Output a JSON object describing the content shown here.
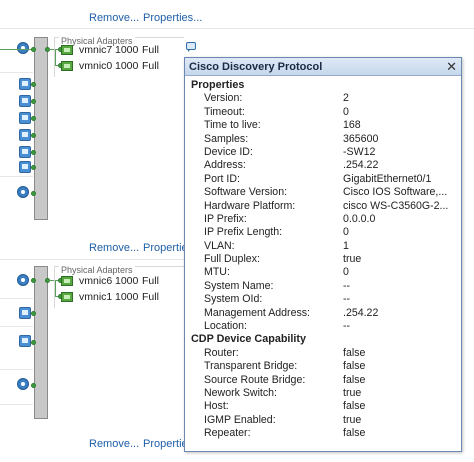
{
  "switches": [
    {
      "links": {
        "remove": "Remove...",
        "properties": "Properties..."
      },
      "physical_adapters": {
        "label": "Physical Adapters",
        "nics": [
          {
            "name": "vmnic7",
            "speed": "1000",
            "duplex": "Full"
          },
          {
            "name": "vmnic0",
            "speed": "1000",
            "duplex": "Full"
          }
        ]
      }
    },
    {
      "links": {
        "remove": "Remove...",
        "properties": "Properties"
      },
      "physical_adapters": {
        "label": "Physical Adapters",
        "nics": [
          {
            "name": "vmnic6",
            "speed": "1000",
            "duplex": "Full"
          },
          {
            "name": "vmnic1",
            "speed": "1000",
            "duplex": "Full"
          }
        ]
      }
    },
    {
      "links": {
        "remove": "Remove...",
        "properties": "Properties"
      }
    }
  ],
  "cdp_popup": {
    "title": "Cisco Discovery Protocol",
    "close_glyph": "✕",
    "properties_heading": "Properties",
    "properties": [
      {
        "k": "Version:",
        "v": "2"
      },
      {
        "k": "Timeout:",
        "v": "0"
      },
      {
        "k": "Time to live:",
        "v": "168"
      },
      {
        "k": "Samples:",
        "v": "365600"
      },
      {
        "k": "Device ID:",
        "v": "-SW12"
      },
      {
        "k": "Address:",
        "v": ".254.22"
      },
      {
        "k": "Port ID:",
        "v": "GigabitEthernet0/1"
      },
      {
        "k": "Software Version:",
        "v": "Cisco IOS Software,..."
      },
      {
        "k": "Hardware Platform:",
        "v": "cisco WS-C3560G-2..."
      },
      {
        "k": "IP Prefix:",
        "v": "0.0.0.0"
      },
      {
        "k": "IP Prefix Length:",
        "v": "0"
      },
      {
        "k": "VLAN:",
        "v": "1"
      },
      {
        "k": "Full Duplex:",
        "v": "true"
      },
      {
        "k": "MTU:",
        "v": "0"
      },
      {
        "k": "System Name:",
        "v": "--"
      },
      {
        "k": "System OId:",
        "v": "--"
      },
      {
        "k": "Management Address:",
        "v": ".254.22"
      },
      {
        "k": "Location:",
        "v": "--"
      }
    ],
    "capability_heading": "CDP Device Capability",
    "capabilities": [
      {
        "k": "Router:",
        "v": "false"
      },
      {
        "k": "Transparent Bridge:",
        "v": "false"
      },
      {
        "k": "Source Route Bridge:",
        "v": "false"
      },
      {
        "k": "Nework Switch:",
        "v": "true"
      },
      {
        "k": "Host:",
        "v": "false"
      },
      {
        "k": "IGMP Enabled:",
        "v": "true"
      },
      {
        "k": "Repeater:",
        "v": "false"
      }
    ]
  },
  "icons": {
    "port_group": "port-group-icon",
    "vmkernel": "vmkernel-port-icon",
    "nic": "network-adapter-icon",
    "cdp": "cdp-info-icon",
    "close": "close-icon"
  },
  "colors": {
    "link": "#1f5fa8",
    "popup_header": "#c6d7ec",
    "connector": "#3f9a3f"
  }
}
